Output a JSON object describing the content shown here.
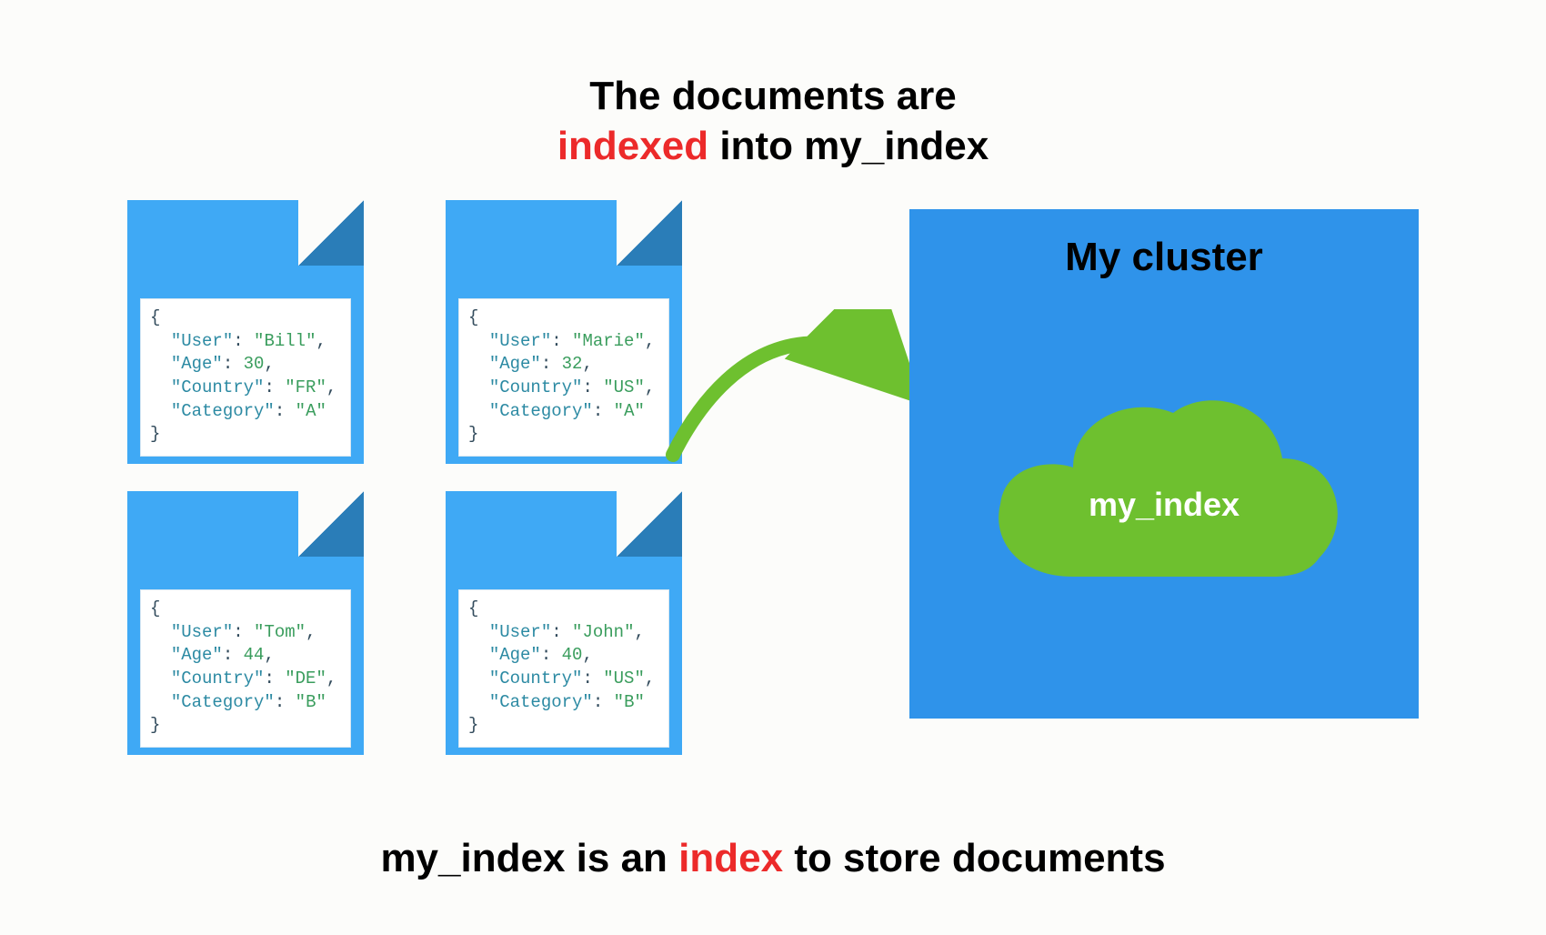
{
  "colors": {
    "doc_bg": "#3fa9f5",
    "doc_fold": "#2a7db8",
    "cluster_bg": "#2f93ea",
    "cloud_fill": "#6ec02f",
    "arrow_fill": "#6ec02f",
    "highlight": "#ec2a2a"
  },
  "heading_top": {
    "line1": "The documents are",
    "line2_highlight": "indexed",
    "line2_rest": " into my_index"
  },
  "heading_bottom": {
    "pre": "my_index is an ",
    "highlight": "index",
    "post": " to store documents"
  },
  "cluster": {
    "title": "My cluster",
    "index_label": "my_index"
  },
  "documents": [
    {
      "User": "Bill",
      "Age": 30,
      "Country": "FR",
      "Category": "A"
    },
    {
      "User": "Marie",
      "Age": 32,
      "Country": "US",
      "Category": "A"
    },
    {
      "User": "Tom",
      "Age": 44,
      "Country": "DE",
      "Category": "B"
    },
    {
      "User": "John",
      "Age": 40,
      "Country": "US",
      "Category": "B"
    }
  ]
}
